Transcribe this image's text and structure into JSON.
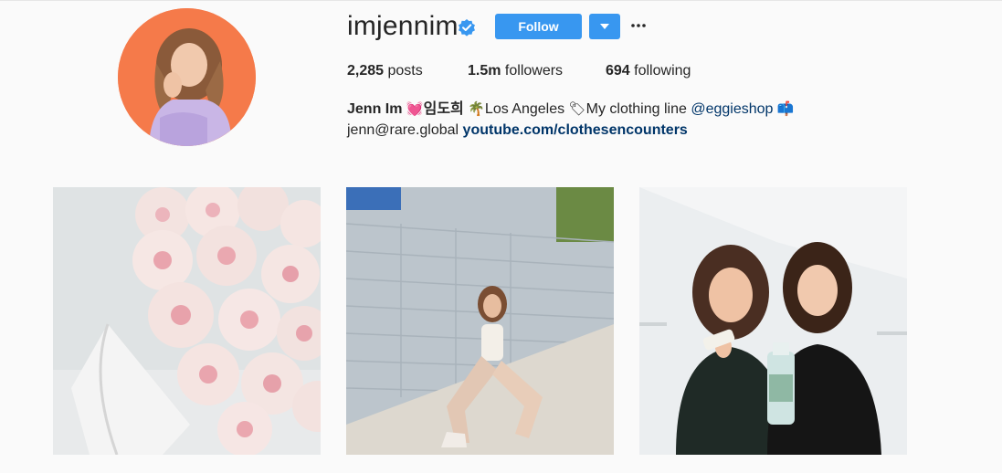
{
  "profile": {
    "username": "imjennim",
    "verified_icon": "verified-badge-icon",
    "follow_label": "Follow",
    "dropdown_icon": "chevron-down-icon",
    "more_icon": "more-options-icon",
    "stats": {
      "posts_count": "2,285",
      "posts_label": "posts",
      "followers_count": "1.5m",
      "followers_label": "followers",
      "following_count": "694",
      "following_label": "following"
    },
    "bio": {
      "name": "Jenn Im",
      "heart": "💓",
      "korean_name": "임도희",
      "palm": "🌴",
      "location": "Los Angeles",
      "tag": "🏷",
      "clothing_text": "My clothing line",
      "mention": "@eggieshop",
      "mailbox": "📫",
      "email": "jenn@rare.global",
      "website": "youtube.com/clothesencounters"
    }
  },
  "posts": [
    {
      "alt_icon": "roses-photo"
    },
    {
      "alt_icon": "wall-portrait-photo"
    },
    {
      "alt_icon": "two-women-product-photo"
    }
  ],
  "colors": {
    "accent": "#3897f0",
    "link": "#003569",
    "avatar_bg": "#f57a4a"
  }
}
